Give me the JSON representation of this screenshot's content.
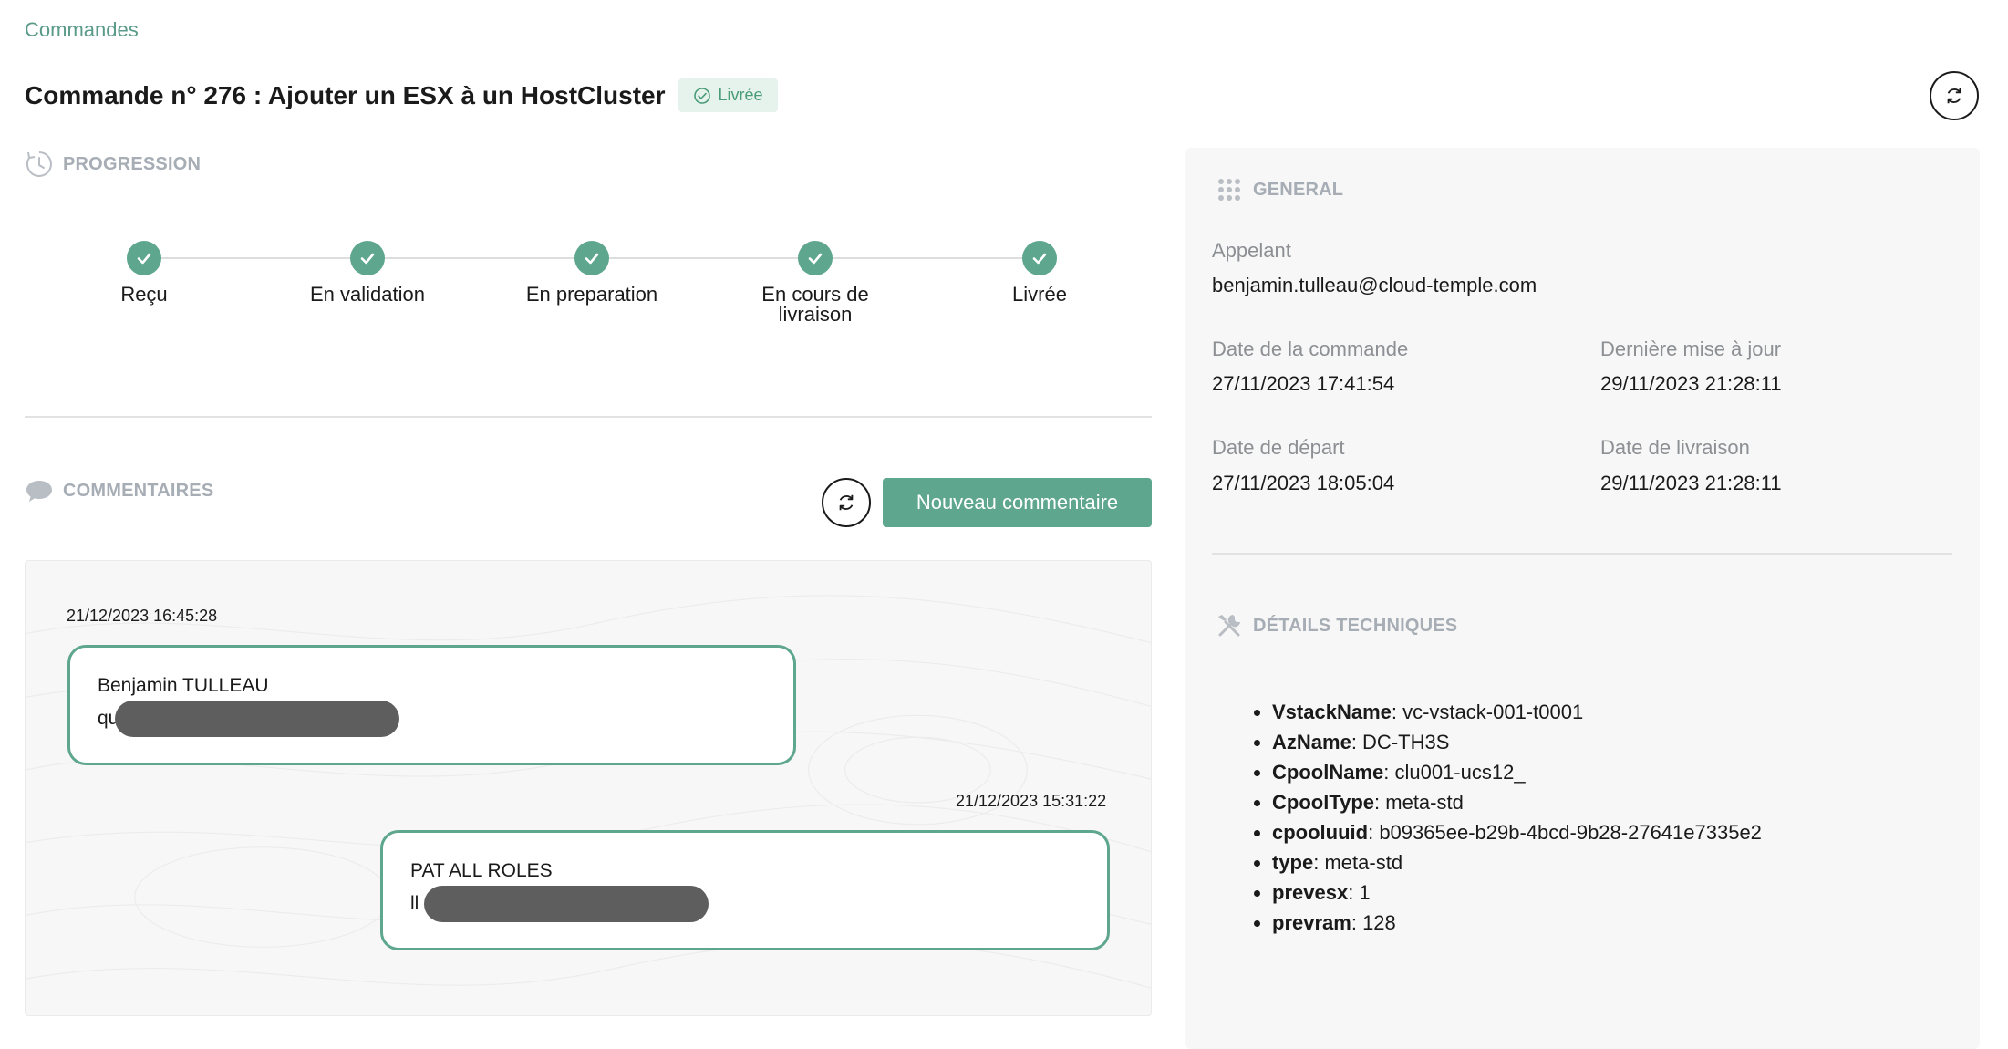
{
  "breadcrumb": "Commandes",
  "title": "Commande n° 276 :  Ajouter un ESX à un HostCluster",
  "status_badge": "Livrée",
  "progression": {
    "header": "PROGRESSION",
    "steps": [
      "Reçu",
      "En validation",
      "En preparation",
      "En cours de livraison",
      "Livrée"
    ]
  },
  "comments": {
    "header": "COMMENTAIRES",
    "new_button": "Nouveau commentaire",
    "items": [
      {
        "timestamp": "21/12/2023 16:45:28",
        "author": "Benjamin TULLEAU",
        "text_visible": "qu"
      },
      {
        "timestamp": "21/12/2023 15:31:22",
        "author": "PAT ALL ROLES",
        "text_visible": "ll"
      }
    ]
  },
  "general": {
    "header": "GENERAL",
    "appelant_label": "Appelant",
    "appelant_value": "benjamin.tulleau@cloud-temple.com",
    "date_commande_label": "Date de la commande",
    "date_commande_value": "27/11/2023 17:41:54",
    "derniere_maj_label": "Dernière mise à jour",
    "derniere_maj_value": "29/11/2023 21:28:11",
    "date_depart_label": "Date de départ",
    "date_depart_value": "27/11/2023 18:05:04",
    "date_livraison_label": "Date de livraison",
    "date_livraison_value": "29/11/2023 21:28:11"
  },
  "technical": {
    "header": "DÉTAILS TECHNIQUES",
    "items": [
      {
        "key": "VstackName",
        "value": ": vc-vstack-001-t0001"
      },
      {
        "key": "AzName",
        "value": ": DC-TH3S"
      },
      {
        "key": "CpoolName",
        "value": ": clu001-ucs12_"
      },
      {
        "key": "CpoolType",
        "value": ": meta-std"
      },
      {
        "key": "cpooluuid",
        "value": ": b09365ee-b29b-4bcd-9b28-27641e7335e2"
      },
      {
        "key": "type",
        "value": ": meta-std"
      },
      {
        "key": "prevesx",
        "value": ": 1"
      },
      {
        "key": "prevram",
        "value": ": 128"
      }
    ]
  },
  "colors": {
    "accent": "#5ea68e",
    "badge_bg": "#e6f2ec",
    "section_header": "#a7adb5",
    "panel_bg": "#f7f7f7"
  }
}
